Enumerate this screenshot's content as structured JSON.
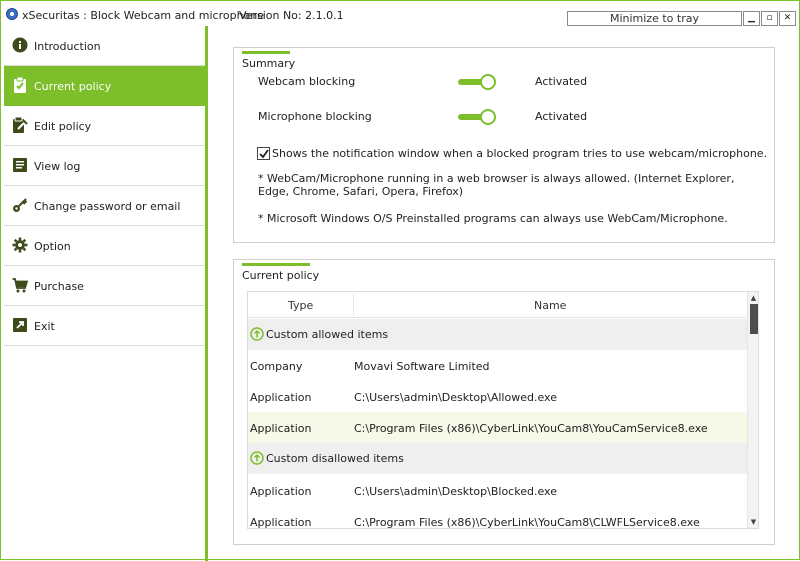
{
  "window": {
    "title": "xSecuritas : Block Webcam and microphone",
    "version": "Version No: 2.1.0.1",
    "minimize_tray_label": "Minimize to tray",
    "min_glyph": "▁",
    "max_glyph": "▫",
    "close_glyph": "✕"
  },
  "sidebar": {
    "items": [
      {
        "label": "Introduction",
        "icon": "info-icon"
      },
      {
        "label": "Current policy",
        "icon": "clipboard-check-icon",
        "active": true
      },
      {
        "label": "Edit policy",
        "icon": "edit-clipboard-icon"
      },
      {
        "label": "View log",
        "icon": "log-icon"
      },
      {
        "label": "Change password or email",
        "icon": "key-icon"
      },
      {
        "label": "Option",
        "icon": "gear-icon"
      },
      {
        "label": "Purchase",
        "icon": "cart-icon"
      },
      {
        "label": "Exit",
        "icon": "exit-icon"
      }
    ]
  },
  "summary": {
    "title": "Summary",
    "webcam_label": "Webcam blocking",
    "webcam_status": "Activated",
    "mic_label": "Microphone blocking",
    "mic_status": "Activated",
    "notify_label": "Shows the notification window when a blocked program tries to use webcam/microphone.",
    "notify_checked": true,
    "note_browser": "* WebCam/Microphone running in a web browser is always allowed. (Internet Explorer, Edge, Chrome, Safari, Opera, Firefox)",
    "note_preinstalled": "* Microsoft Windows O/S Preinstalled programs can always use WebCam/Microphone."
  },
  "policy": {
    "title": "Current policy",
    "col_type": "Type",
    "col_name": "Name",
    "rows": [
      {
        "kind": "group",
        "label": "Custom allowed items"
      },
      {
        "kind": "item",
        "type": "Company",
        "name": "Movavi Software Limited"
      },
      {
        "kind": "item",
        "type": "Application",
        "name": "C:\\Users\\admin\\Desktop\\Allowed.exe"
      },
      {
        "kind": "item",
        "type": "Application",
        "name": "C:\\Program Files (x86)\\CyberLink\\YouCam8\\YouCamService8.exe",
        "highlight": true
      },
      {
        "kind": "group",
        "label": "Custom disallowed items"
      },
      {
        "kind": "item",
        "type": "Application",
        "name": "C:\\Users\\admin\\Desktop\\Blocked.exe"
      },
      {
        "kind": "item",
        "type": "Application",
        "name": "C:\\Program Files (x86)\\CyberLink\\YouCam8\\CLWFLService8.exe"
      }
    ]
  },
  "colors": {
    "accent": "#7cbf2a"
  }
}
